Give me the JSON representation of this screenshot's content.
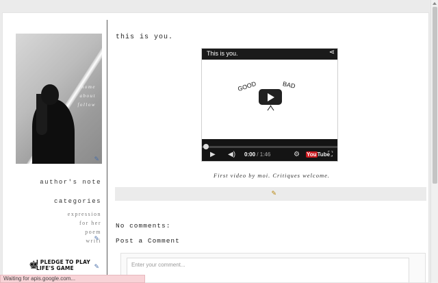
{
  "sidebar": {
    "nav": [
      {
        "label": "home"
      },
      {
        "label": "about"
      },
      {
        "label": "follow"
      }
    ],
    "authors_note": "author's note",
    "categories_heading": "categories",
    "categories": [
      {
        "label": "expression"
      },
      {
        "label": "for her"
      },
      {
        "label": "poem"
      },
      {
        "label": "writi"
      }
    ],
    "pledge": {
      "line1": "I PLEDGE TO PLAY",
      "line2": "LIFE'S GAME"
    }
  },
  "post": {
    "title": "this is you.",
    "video": {
      "title": "This is you.",
      "words": {
        "good": "GOOD",
        "bad": "BAD"
      },
      "time_current": "0:00",
      "time_duration": "/ 1:46",
      "logo": {
        "you": "You",
        "tube": "Tube"
      },
      "progress": 0.0
    },
    "caption": "First video by moi. Critiques welcome."
  },
  "comments": {
    "count_label": "No comments:",
    "post_label": "Post a Comment",
    "placeholder": "Enter your comment..."
  },
  "status_bar": "Waiting for apis.google.com...",
  "colors": {
    "edit_icon": "#4a6fa8",
    "status_bg": "#f8d3d7",
    "youtube_red": "#cc181e"
  }
}
